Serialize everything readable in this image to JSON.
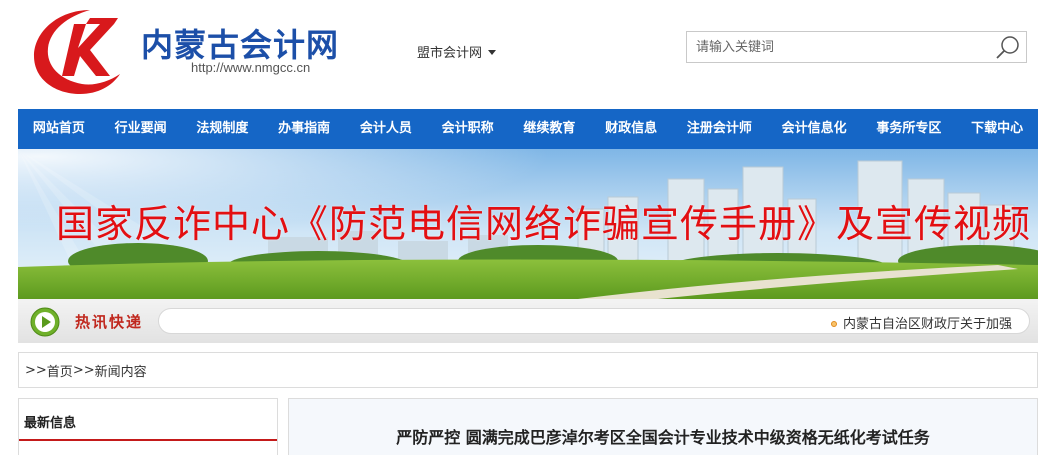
{
  "header": {
    "site_name": "内蒙古会计网",
    "site_url": "http://www.nmgcc.cn",
    "city_select": "盟市会计网",
    "search_placeholder": "请输入关键词"
  },
  "nav": {
    "items": [
      {
        "label": "网站首页"
      },
      {
        "label": "行业要闻"
      },
      {
        "label": "法规制度"
      },
      {
        "label": "办事指南"
      },
      {
        "label": "会计人员"
      },
      {
        "label": "会计职称"
      },
      {
        "label": "继续教育"
      },
      {
        "label": "财政信息"
      },
      {
        "label": "注册会计师"
      },
      {
        "label": "会计信息化"
      },
      {
        "label": "事务所专区"
      },
      {
        "label": "下载中心"
      }
    ]
  },
  "banner": {
    "title": "国家反诈中心《防范电信网络诈骗宣传手册》及宣传视频"
  },
  "hot_news": {
    "label": "热讯快递",
    "item": "内蒙古自治区财政厅关于加强"
  },
  "breadcrumb": {
    "prefix": ">>",
    "home": "首页",
    "separator": ">>",
    "current": "新闻内容"
  },
  "sidebar": {
    "title": "最新信息"
  },
  "article": {
    "title": "严防严控 圆满完成巴彦淖尔考区全国会计专业技术中级资格无纸化考试任务"
  },
  "colors": {
    "nav_bg": "#1566c6",
    "brand_blue": "#1c4fa8",
    "banner_title": "#e30f12",
    "hot_label": "#c0281e",
    "sidebar_accent": "#c41a1a"
  }
}
